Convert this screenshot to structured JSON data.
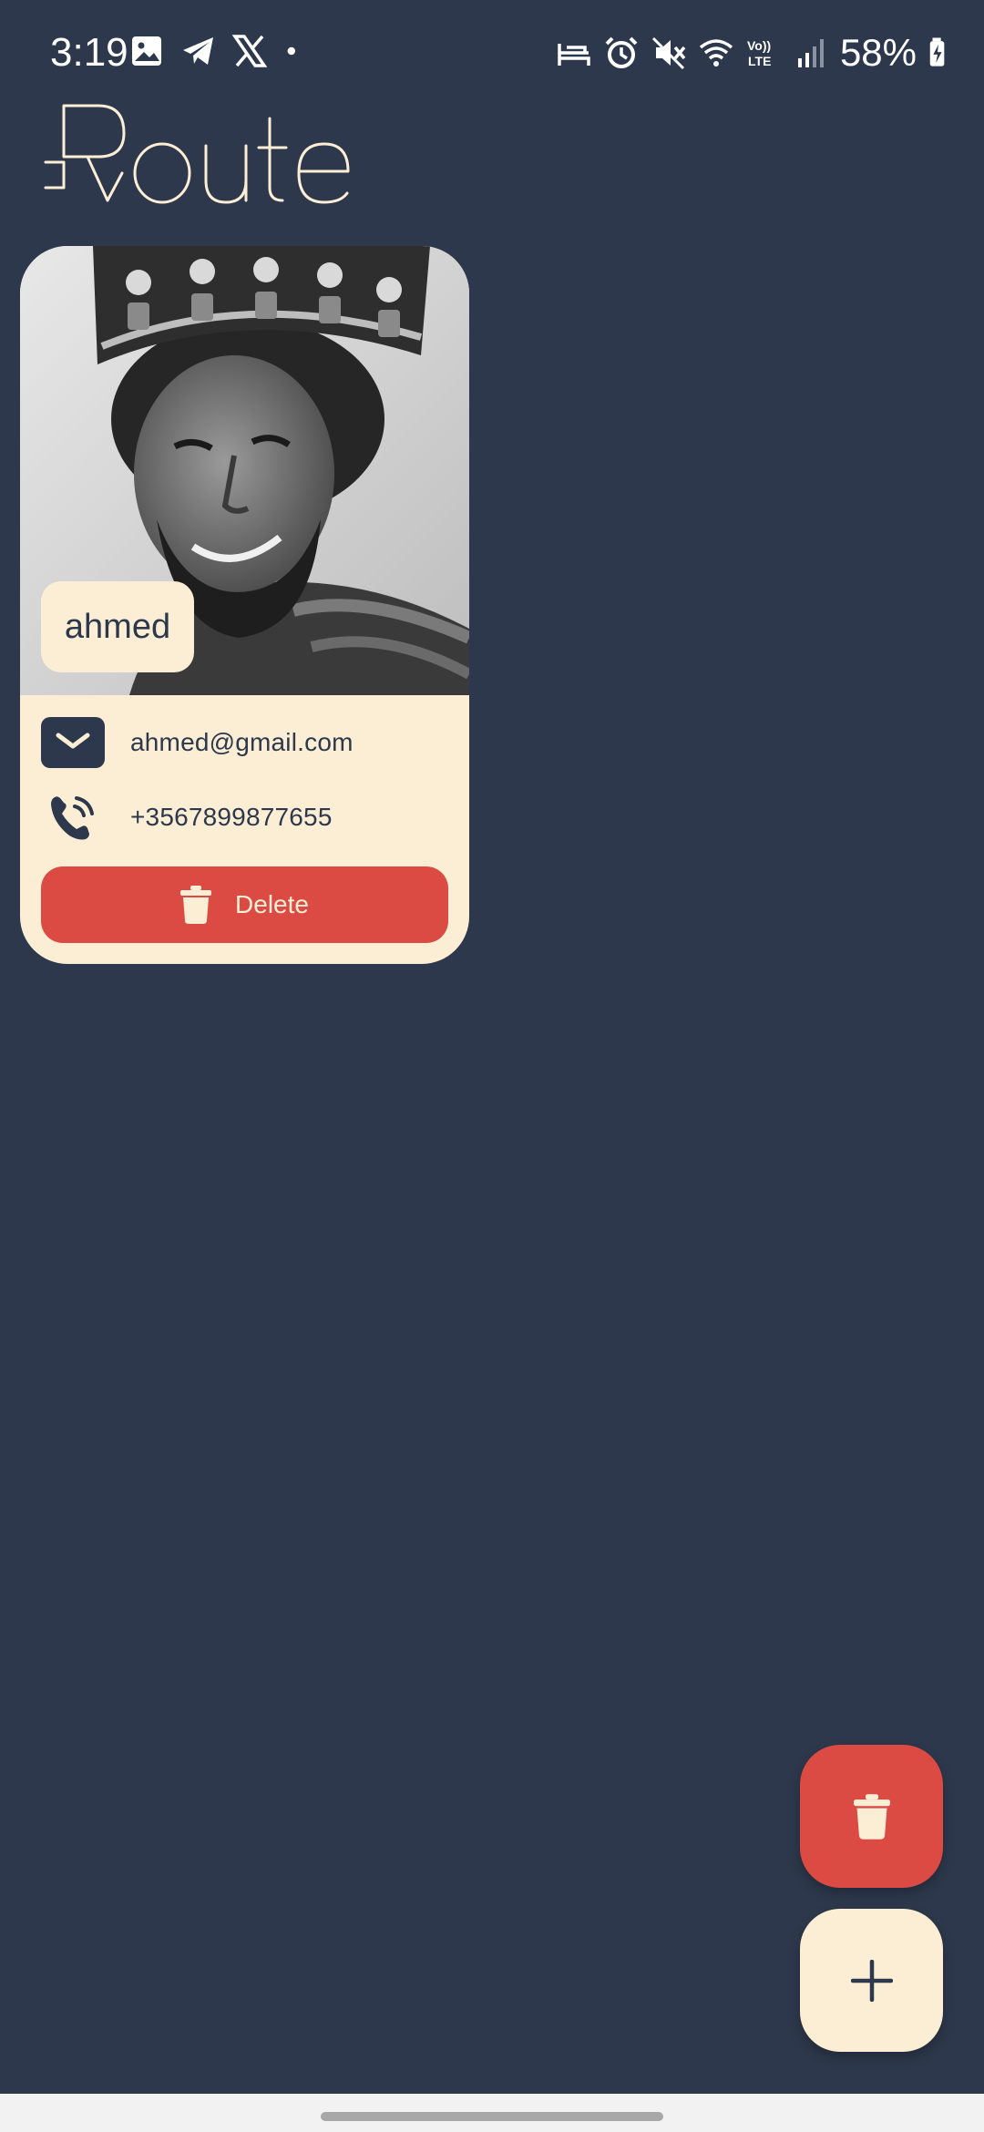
{
  "status_bar": {
    "time": "3:19",
    "battery": "58%",
    "left_icons": [
      "gallery-icon",
      "telegram-icon",
      "x-icon",
      "dot-icon"
    ],
    "right_icons": [
      "sleep-icon",
      "alarm-icon",
      "mute-icon",
      "wifi-icon",
      "volte-icon",
      "signal-icon",
      "battery-icon"
    ]
  },
  "app": {
    "logo_text": "Route"
  },
  "contact_card": {
    "name": "ahmed",
    "email": "ahmed@gmail.com",
    "phone": "+3567899877655",
    "delete_label": "Delete"
  },
  "fabs": {
    "delete_icon": "trash-icon",
    "add_icon": "plus-icon"
  },
  "colors": {
    "background": "#2D384C",
    "card": "#FBEED5",
    "danger": "#DB4B43",
    "text_dark": "#2D384C"
  }
}
